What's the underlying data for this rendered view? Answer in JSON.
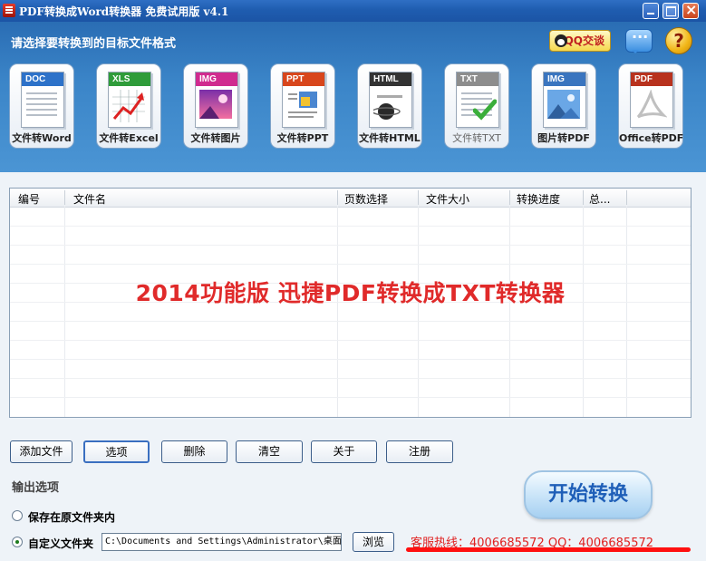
{
  "window": {
    "title": "PDF转换成Word转换器 免费试用版 v4.1"
  },
  "header": {
    "prompt": "请选择要转换到的目标文件格式",
    "qq_button": "QQ交谈"
  },
  "tiles": [
    {
      "badge": "DOC",
      "label": "文件转Word",
      "color": "#2d72c9"
    },
    {
      "badge": "XLS",
      "label": "文件转Excel",
      "color": "#2f9c3a"
    },
    {
      "badge": "IMG",
      "label": "文件转图片",
      "color": "#d02b8f"
    },
    {
      "badge": "PPT",
      "label": "文件转PPT",
      "color": "#d8461c"
    },
    {
      "badge": "HTML",
      "label": "文件转HTML",
      "color": "#333333"
    },
    {
      "badge": "TXT",
      "label": "文件转TXT",
      "color": "#8d8d8d"
    },
    {
      "badge": "IMG",
      "label": "图片转PDF",
      "color": "#3a75bf"
    },
    {
      "badge": "PDF",
      "label": "Office转PDF",
      "color": "#b8321e"
    }
  ],
  "file_list": {
    "columns": [
      "编号",
      "文件名",
      "页数选择",
      "文件大小",
      "转换进度",
      "总..."
    ],
    "watermark": "2014功能版  迅捷PDF转换成TXT转换器"
  },
  "buttons": {
    "add_file": "添加文件",
    "options": "选项",
    "delete": "删除",
    "clear": "清空",
    "about": "关于",
    "register": "注册"
  },
  "output": {
    "title": "输出选项",
    "option_same_folder": "保存在原文件夹内",
    "option_custom_folder": "自定义文件夹",
    "path": "C:\\Documents and Settings\\Administrator\\桌面",
    "browse": "浏览"
  },
  "start_button": "开始转换",
  "hotline": "客服热线：4006685572 QQ：4006685572"
}
